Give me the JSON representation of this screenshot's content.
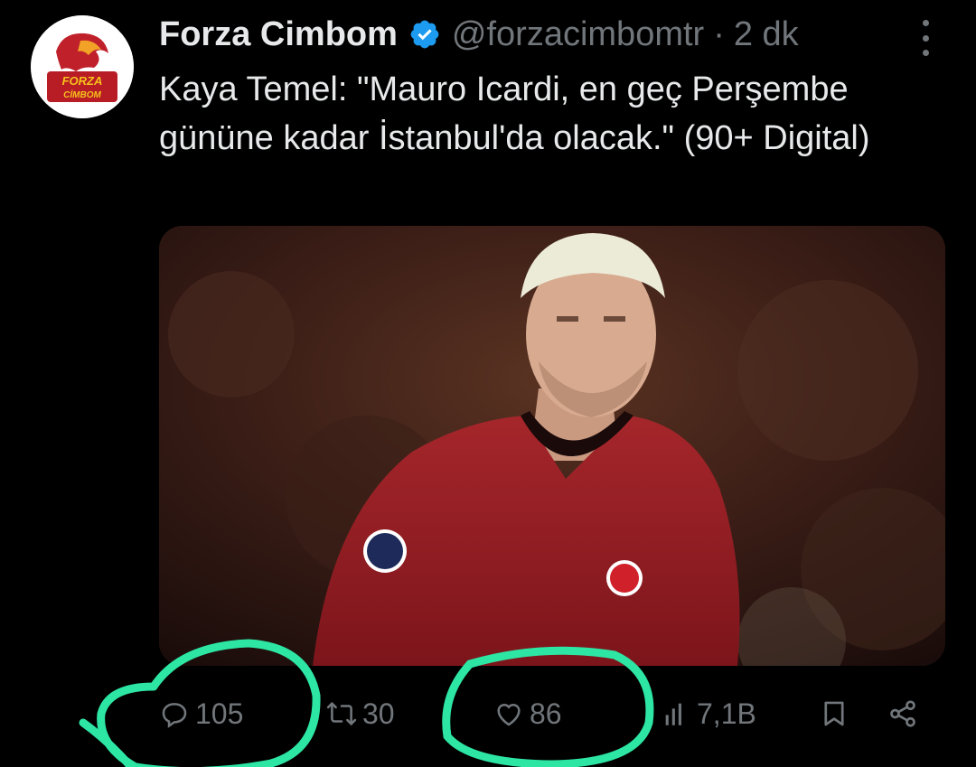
{
  "tweet": {
    "author_name": "Forza Cimbom",
    "handle": "@forzacimbomtr",
    "separator": "·",
    "time": "2 dk",
    "text": "Kaya Temel: \"Mauro Icardi, en geç Perşembe gününe kadar İstanbul'da olacak.\" (90+ Digital)",
    "avatar_text_top": "FORZA",
    "avatar_text_bottom": "CİMBOM"
  },
  "actions": {
    "replies": "105",
    "reposts": "30",
    "likes": "86",
    "views": "7,1B"
  },
  "icons": {
    "verified": "verified-badge-icon",
    "more": "more-dots-icon",
    "reply": "reply-bubble-icon",
    "repost": "repost-icon",
    "like": "heart-icon",
    "views": "views-bar-chart-icon",
    "bookmark": "bookmark-icon",
    "share": "share-icon"
  },
  "colors": {
    "background": "#000000",
    "text": "#e7e9ea",
    "muted": "#71767b",
    "verified": "#1d9bf0",
    "annotation": "#2de6a4"
  }
}
